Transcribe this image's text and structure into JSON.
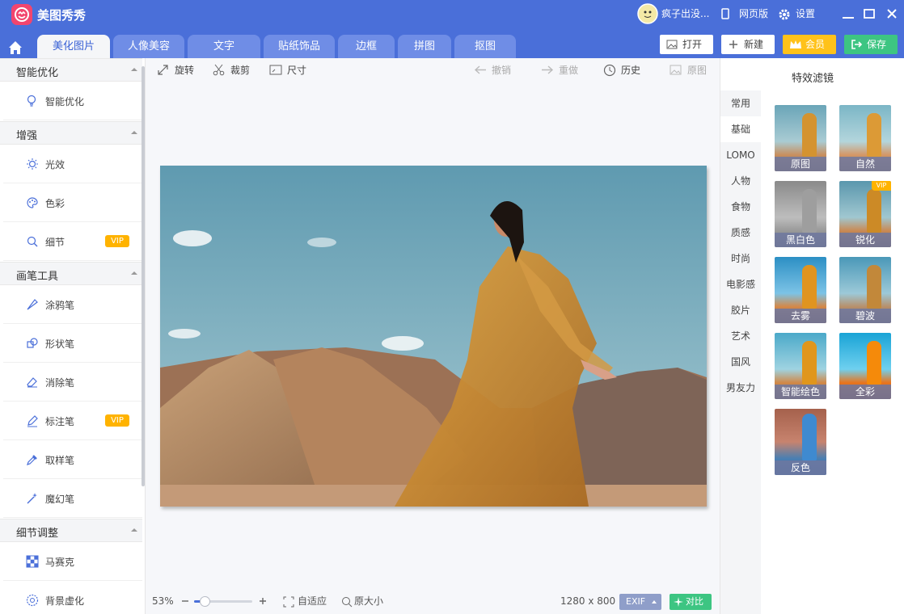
{
  "app": {
    "name": "美图秀秀"
  },
  "titlebar": {
    "user_name": "疯子出没...",
    "web_version": "网页版",
    "settings": "设置"
  },
  "tabs": [
    {
      "label": "美化图片",
      "active": true
    },
    {
      "label": "人像美容"
    },
    {
      "label": "文字"
    },
    {
      "label": "贴纸饰品"
    },
    {
      "label": "边框"
    },
    {
      "label": "拼图"
    },
    {
      "label": "抠图"
    }
  ],
  "header_buttons": {
    "open": "打开",
    "new": "新建",
    "vip": "会员",
    "save": "保存"
  },
  "sidebar": {
    "sections": [
      {
        "title": "智能优化",
        "items": [
          {
            "label": "智能优化",
            "icon": "bulb-icon"
          }
        ]
      },
      {
        "title": "增强",
        "items": [
          {
            "label": "光效",
            "icon": "sun-icon"
          },
          {
            "label": "色彩",
            "icon": "palette-icon"
          },
          {
            "label": "细节",
            "icon": "magnifier-icon",
            "vip": "VIP"
          }
        ]
      },
      {
        "title": "画笔工具",
        "items": [
          {
            "label": "涂鸦笔",
            "icon": "brush-icon"
          },
          {
            "label": "形状笔",
            "icon": "shape-icon"
          },
          {
            "label": "消除笔",
            "icon": "eraser-icon"
          },
          {
            "label": "标注笔",
            "icon": "pen-icon",
            "vip": "VIP"
          },
          {
            "label": "取样笔",
            "icon": "dropper-icon"
          },
          {
            "label": "魔幻笔",
            "icon": "magic-wand-icon"
          }
        ]
      },
      {
        "title": "细节调整",
        "items": [
          {
            "label": "马赛克",
            "icon": "mosaic-icon"
          },
          {
            "label": "背景虚化",
            "icon": "blur-icon"
          }
        ]
      }
    ]
  },
  "toolbar": {
    "rotate": "旋转",
    "crop": "裁剪",
    "size": "尺寸",
    "undo": "撤销",
    "redo": "重做",
    "history": "历史",
    "original": "原图"
  },
  "statusbar": {
    "zoom": "53%",
    "zoom_fraction": 0.18,
    "fit": "自适应",
    "actual_size": "原大小",
    "dimensions": "1280 x 800",
    "exif": "EXIF",
    "compare": "对比"
  },
  "filters_panel": {
    "title": "特效滤镜",
    "categories": [
      "常用",
      "基础",
      "LOMO",
      "人物",
      "食物",
      "质感",
      "时尚",
      "电影感",
      "胶片",
      "艺术",
      "国风",
      "男友力"
    ],
    "active_category": "基础",
    "filters": [
      {
        "label": "原图",
        "style": "normal"
      },
      {
        "label": "自然",
        "style": "natural"
      },
      {
        "label": "黑白色",
        "style": "bw"
      },
      {
        "label": "锐化",
        "style": "sharp",
        "vip": "VIP"
      },
      {
        "label": "去雾",
        "style": "dehaze"
      },
      {
        "label": "碧波",
        "style": "teal"
      },
      {
        "label": "智能绘色",
        "style": "vivid"
      },
      {
        "label": "全彩",
        "style": "full"
      },
      {
        "label": "反色",
        "style": "invert"
      }
    ]
  },
  "colors": {
    "accent": "#4a6fd9",
    "vip": "#ffb300",
    "save": "#3dc582",
    "pink": "#f2456e"
  }
}
